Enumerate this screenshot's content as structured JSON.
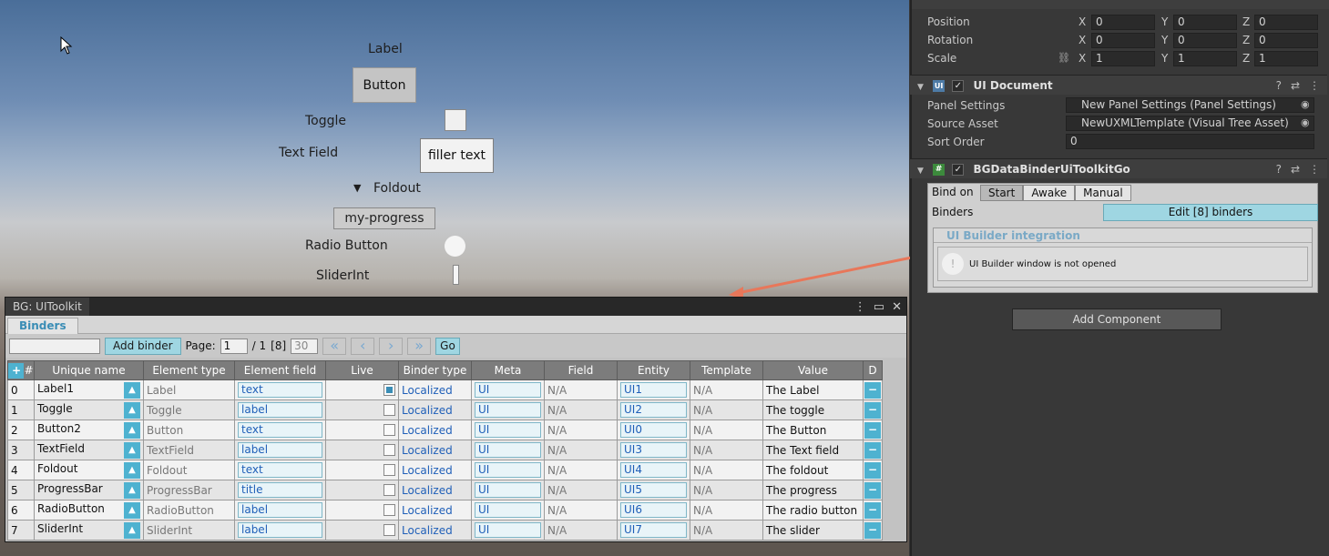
{
  "scene": {
    "label": "Label",
    "button": "Button",
    "toggle": "Toggle",
    "text_field_label": "Text Field",
    "text_field_value": "filler text",
    "foldout_arrow": "▼",
    "foldout": "Foldout",
    "progress": "my-progress",
    "radio": "Radio Button",
    "slider": "SliderInt"
  },
  "window": {
    "title": "BG: UIToolkit",
    "tab": "Binders",
    "add_binder": "Add binder",
    "page_label": "Page:",
    "page_value": "1",
    "page_total": "/ 1",
    "count": "[8]",
    "page_size": "30",
    "go": "Go",
    "columns": [
      "#",
      "Unique name",
      "Element type",
      "Element field",
      "Live",
      "Binder type",
      "Meta",
      "Field",
      "Entity",
      "Template",
      "Value",
      "D"
    ],
    "rows": [
      {
        "i": "0",
        "name": "Label1",
        "type": "Label",
        "field": "text",
        "live": true,
        "binder": "Localized",
        "meta": "UI",
        "f": "N/A",
        "entity": "UI1",
        "tpl": "N/A",
        "value": "The Label"
      },
      {
        "i": "1",
        "name": "Toggle",
        "type": "Toggle",
        "field": "label",
        "live": false,
        "binder": "Localized",
        "meta": "UI",
        "f": "N/A",
        "entity": "UI2",
        "tpl": "N/A",
        "value": "The toggle"
      },
      {
        "i": "2",
        "name": "Button2",
        "type": "Button",
        "field": "text",
        "live": false,
        "binder": "Localized",
        "meta": "UI",
        "f": "N/A",
        "entity": "UI0",
        "tpl": "N/A",
        "value": "The Button"
      },
      {
        "i": "3",
        "name": "TextField",
        "type": "TextField",
        "field": "label",
        "live": false,
        "binder": "Localized",
        "meta": "UI",
        "f": "N/A",
        "entity": "UI3",
        "tpl": "N/A",
        "value": "The Text field"
      },
      {
        "i": "4",
        "name": "Foldout",
        "type": "Foldout",
        "field": "text",
        "live": false,
        "binder": "Localized",
        "meta": "UI",
        "f": "N/A",
        "entity": "UI4",
        "tpl": "N/A",
        "value": "The foldout"
      },
      {
        "i": "5",
        "name": "ProgressBar",
        "type": "ProgressBar",
        "field": "title",
        "live": false,
        "binder": "Localized",
        "meta": "UI",
        "f": "N/A",
        "entity": "UI5",
        "tpl": "N/A",
        "value": "The progress"
      },
      {
        "i": "6",
        "name": "RadioButton",
        "type": "RadioButton",
        "field": "label",
        "live": false,
        "binder": "Localized",
        "meta": "UI",
        "f": "N/A",
        "entity": "UI6",
        "tpl": "N/A",
        "value": "The radio button"
      },
      {
        "i": "7",
        "name": "SliderInt",
        "type": "SliderInt",
        "field": "label",
        "live": false,
        "binder": "Localized",
        "meta": "UI",
        "f": "N/A",
        "entity": "UI7",
        "tpl": "N/A",
        "value": "The slider"
      }
    ]
  },
  "inspector": {
    "transform": {
      "position": "Position",
      "rotation": "Rotation",
      "scale": "Scale",
      "pos": [
        "0",
        "0",
        "0"
      ],
      "rot": [
        "0",
        "0",
        "0"
      ],
      "scl": [
        "1",
        "1",
        "1"
      ],
      "axes": [
        "X",
        "Y",
        "Z"
      ]
    },
    "ui_document": {
      "title": "UI Document",
      "panel_settings_label": "Panel Settings",
      "panel_settings_value": "New Panel Settings (Panel Settings)",
      "source_asset_label": "Source Asset",
      "source_asset_value": "NewUXMLTemplate (Visual Tree Asset)",
      "sort_order_label": "Sort Order",
      "sort_order_value": "0"
    },
    "bg_binder": {
      "title": "BGDataBinderUiToolkitGo",
      "bind_on": "Bind on",
      "options": [
        "Start",
        "Awake",
        "Manual"
      ],
      "binders_label": "Binders",
      "edit_button": "Edit [8] binders",
      "integration_title": "UI Builder integration",
      "integration_msg": "UI Builder window is not opened"
    },
    "add_component": "Add Component"
  }
}
